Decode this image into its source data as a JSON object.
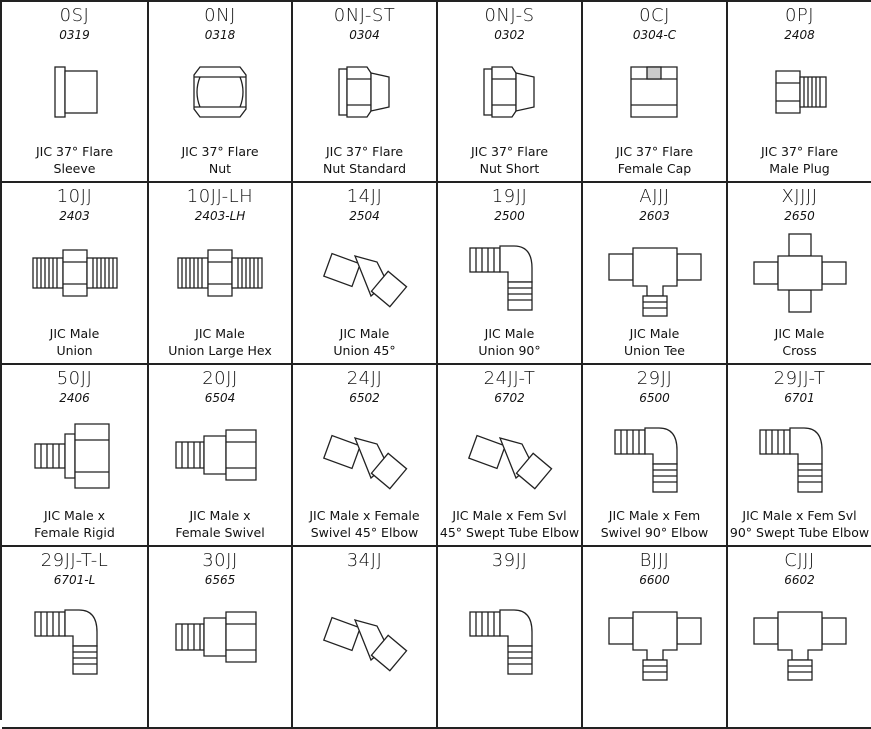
{
  "items": [
    {
      "code": "0SJ",
      "part": "0319",
      "line1": "JIC 37° Flare",
      "line2": "Sleeve",
      "icon": "sleeve"
    },
    {
      "code": "0NJ",
      "part": "0318",
      "line1": "JIC 37° Flare",
      "line2": "Nut",
      "icon": "nut"
    },
    {
      "code": "0NJ-ST",
      "part": "0304",
      "line1": "JIC 37° Flare",
      "line2": "Nut Standard",
      "icon": "taper-nut"
    },
    {
      "code": "0NJ-S",
      "part": "0302",
      "line1": "JIC 37° Flare",
      "line2": "Nut Short",
      "icon": "taper-nut"
    },
    {
      "code": "0CJ",
      "part": "0304-C",
      "line1": "JIC 37° Flare",
      "line2": "Female Cap",
      "icon": "cap"
    },
    {
      "code": "0PJ",
      "part": "2408",
      "line1": "JIC 37° Flare",
      "line2": "Male Plug",
      "icon": "plug"
    },
    {
      "code": "10JJ",
      "part": "2403",
      "line1": "JIC Male",
      "line2": "Union",
      "icon": "union"
    },
    {
      "code": "10JJ-LH",
      "part": "2403-LH",
      "line1": "JIC Male",
      "line2": "Union Large Hex",
      "icon": "union"
    },
    {
      "code": "14JJ",
      "part": "2504",
      "line1": "JIC Male",
      "line2": "Union 45°",
      "icon": "elbow45"
    },
    {
      "code": "19JJ",
      "part": "2500",
      "line1": "JIC Male",
      "line2": "Union 90°",
      "icon": "elbow90"
    },
    {
      "code": "AJJJ",
      "part": "2603",
      "line1": "JIC Male",
      "line2": "Union Tee",
      "icon": "tee"
    },
    {
      "code": "XJJJJ",
      "part": "2650",
      "line1": "JIC Male",
      "line2": "Cross",
      "icon": "cross"
    },
    {
      "code": "50JJ",
      "part": "2406",
      "line1": "JIC Male x",
      "line2": "Female Rigid",
      "icon": "rigid"
    },
    {
      "code": "20JJ",
      "part": "6504",
      "line1": "JIC Male x",
      "line2": "Female Swivel",
      "icon": "swivel"
    },
    {
      "code": "24JJ",
      "part": "6502",
      "line1": "JIC Male x Female",
      "line2": "Swivel 45° Elbow",
      "icon": "elbow45"
    },
    {
      "code": "24JJ-T",
      "part": "6702",
      "line1": "JIC Male x Fem Svl",
      "line2": "45° Swept Tube Elbow",
      "icon": "elbow45"
    },
    {
      "code": "29JJ",
      "part": "6500",
      "line1": "JIC Male x Fem",
      "line2": "Swivel 90° Elbow",
      "icon": "elbow90"
    },
    {
      "code": "29JJ-T",
      "part": "6701",
      "line1": "JIC Male x Fem Svl",
      "line2": "90° Swept Tube Elbow",
      "icon": "elbow90"
    },
    {
      "code": "29JJ-T-L",
      "part": "6701-L",
      "line1": "",
      "line2": "",
      "icon": "elbow90"
    },
    {
      "code": "30JJ",
      "part": "6565",
      "line1": "",
      "line2": "",
      "icon": "swivel"
    },
    {
      "code": "34JJ",
      "part": "",
      "line1": "",
      "line2": "",
      "icon": "elbow45"
    },
    {
      "code": "39JJ",
      "part": "",
      "line1": "",
      "line2": "",
      "icon": "elbow90"
    },
    {
      "code": "BJJJ",
      "part": "6600",
      "line1": "",
      "line2": "",
      "icon": "tee"
    },
    {
      "code": "CJJJ",
      "part": "6602",
      "line1": "",
      "line2": "",
      "icon": "tee"
    }
  ]
}
